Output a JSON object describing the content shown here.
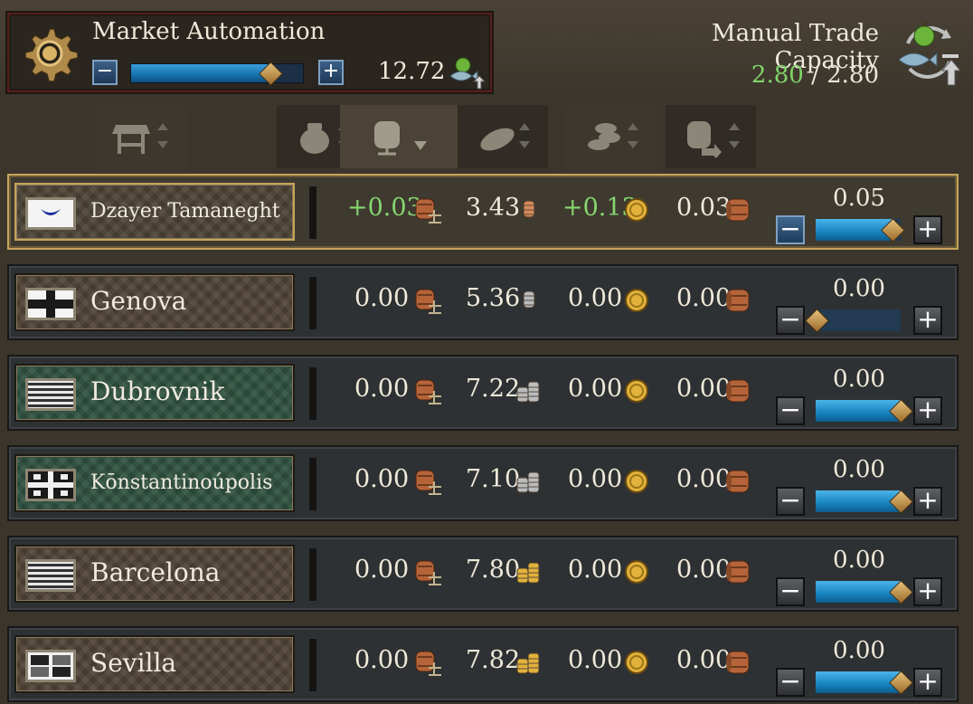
{
  "automation": {
    "title": "Market Automation",
    "value": "12.72",
    "slider_fraction": 0.82,
    "icons": [
      "gear-icon",
      "minus-icon",
      "plus-icon",
      "fish-apple-upload-icon"
    ]
  },
  "capacity": {
    "title": "Manual Trade Capacity",
    "current": "2.80",
    "separator": "/",
    "max": "2.80",
    "icon": "apple-fish-transfer-icon"
  },
  "columns": [
    {
      "icon": "market-stall-icon",
      "sort": "both",
      "state": "normal"
    },
    {
      "icon": "grain-sack-icon",
      "sort": "both",
      "state": "dark"
    },
    {
      "icon": "barrel-scale-icon",
      "sort": "down",
      "state": "active"
    },
    {
      "icon": "bread-icon",
      "sort": "both",
      "state": "dark"
    },
    {
      "icon": "coins-icon",
      "sort": "both",
      "state": "normal"
    },
    {
      "icon": "barrel-arrow-icon",
      "sort": "both",
      "state": "dark"
    }
  ],
  "colors": {
    "green": "#86d66f",
    "accent_gold": "#c5a35a",
    "slider_blue": "#1682bf"
  },
  "rows": [
    {
      "name": "Dzayer Tamaneght",
      "flag": "crescent",
      "bg": "brown",
      "selected": true,
      "small": true,
      "balance": "+0.03",
      "balance_green": true,
      "price": "3.43",
      "price_coin": "copper",
      "profit": "+0.13",
      "profit_green": true,
      "volume": "0.03",
      "slider_value": "0.05",
      "slider_fraction": 0.9
    },
    {
      "name": "Genova",
      "flag": "cross",
      "bg": "brown",
      "selected": false,
      "small": false,
      "balance": "0.00",
      "balance_green": false,
      "price": "5.36",
      "price_coin": "silver",
      "profit": "0.00",
      "profit_green": false,
      "volume": "0.00",
      "slider_value": "0.00",
      "slider_fraction": 0.0
    },
    {
      "name": "Dubrovnik",
      "flag": "stripes",
      "bg": "green",
      "selected": false,
      "small": false,
      "balance": "0.00",
      "balance_green": false,
      "price": "7.22",
      "price_coin": "silver-stack",
      "profit": "0.00",
      "profit_green": false,
      "volume": "0.00",
      "slider_value": "0.00",
      "slider_fraction": 1.0
    },
    {
      "name": "Kōnstantinoúpolis",
      "flag": "byzantine",
      "bg": "green",
      "selected": false,
      "small": true,
      "balance": "0.00",
      "balance_green": false,
      "price": "7.10",
      "price_coin": "silver-stack",
      "profit": "0.00",
      "profit_green": false,
      "volume": "0.00",
      "slider_value": "0.00",
      "slider_fraction": 1.0
    },
    {
      "name": "Barcelona",
      "flag": "stripes",
      "bg": "brown",
      "selected": false,
      "small": false,
      "balance": "0.00",
      "balance_green": false,
      "price": "7.80",
      "price_coin": "gold-stack",
      "profit": "0.00",
      "profit_green": false,
      "volume": "0.00",
      "slider_value": "0.00",
      "slider_fraction": 1.0
    },
    {
      "name": "Sevilla",
      "flag": "castile",
      "bg": "brown",
      "selected": false,
      "small": false,
      "balance": "0.00",
      "balance_green": false,
      "price": "7.82",
      "price_coin": "gold-stack",
      "profit": "0.00",
      "profit_green": false,
      "volume": "0.00",
      "slider_value": "0.00",
      "slider_fraction": 1.0
    }
  ]
}
